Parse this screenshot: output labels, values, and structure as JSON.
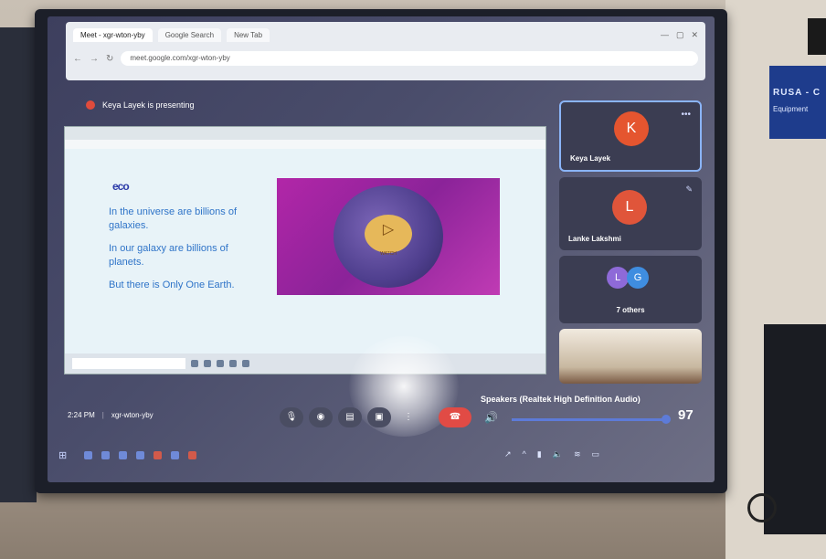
{
  "wall": {
    "notice_line1": "",
    "notice_line2": "RUSA - C",
    "notice_line3": "Equipment"
  },
  "browser": {
    "tabs": [
      {
        "label": "Meet - xgr-wton-yby",
        "active": true
      },
      {
        "label": "Google Search"
      },
      {
        "label": "New Tab"
      }
    ],
    "address": "meet.google.com/xgr-wton-yby"
  },
  "meeting": {
    "presenter_banner": "Keya Layek is presenting",
    "time": "2:24 PM",
    "meeting_code": "xgr-wton-yby",
    "speaker_device": "Speakers (Realtek High Definition Audio)",
    "volume_value": "97",
    "volume_fraction": 0.97
  },
  "slide": {
    "logo_text": "eco",
    "lines": [
      "In the universe are billions of galaxies.",
      "In our galaxy are billions of planets.",
      "But there is Only One Earth."
    ],
    "play_label": "WATCH"
  },
  "participants": [
    {
      "initial": "K",
      "name": "Keya Layek",
      "color": "#e5552f"
    },
    {
      "initial": "L",
      "name": "Lanke Lakshmi",
      "color": "#e0553a"
    }
  ],
  "others": {
    "initials": [
      "L",
      "G"
    ],
    "label": "7 others"
  },
  "icons": {
    "mic": "microphone-icon",
    "camera": "camera-icon",
    "captions": "captions-icon",
    "present": "present-screen-icon",
    "more": "more-options-icon",
    "end_call": "end-call-icon",
    "volume": "speaker-icon"
  }
}
